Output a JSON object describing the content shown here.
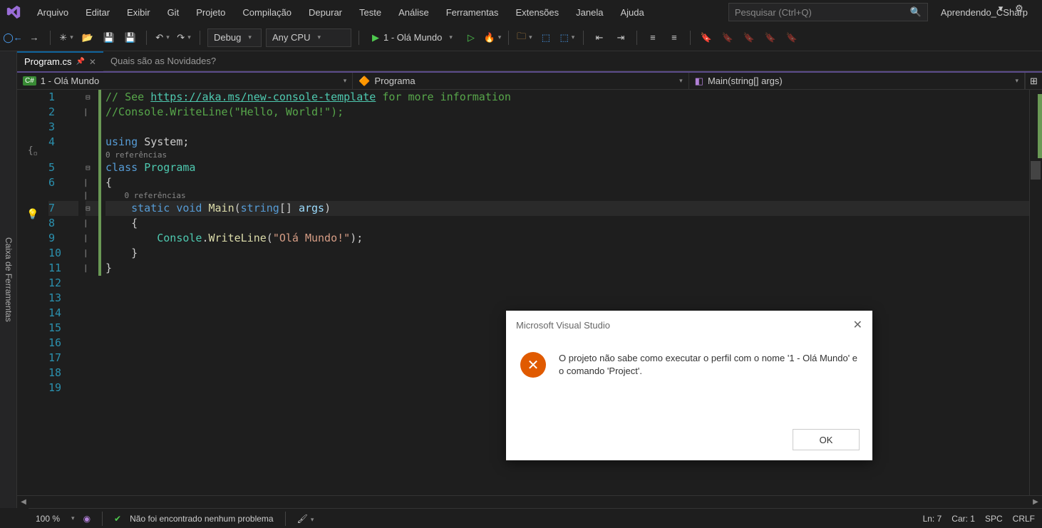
{
  "menu": {
    "items": [
      "Arquivo",
      "Editar",
      "Exibir",
      "Git",
      "Projeto",
      "Compilação",
      "Depurar",
      "Teste",
      "Análise",
      "Ferramentas",
      "Extensões",
      "Janela",
      "Ajuda"
    ]
  },
  "search": {
    "placeholder": "Pesquisar (Ctrl+Q)"
  },
  "solution_name": "Aprendendo_CSharp",
  "toolbar": {
    "config": "Debug",
    "platform": "Any CPU",
    "startup": "1 - Olá Mundo"
  },
  "sidepanel": {
    "label": "Caixa de Ferramentas"
  },
  "tabs": {
    "active": "Program.cs",
    "inactive": "Quais são as Novidades?"
  },
  "navbar": {
    "project": "1 - Olá Mundo",
    "class": "Programa",
    "method": "Main(string[] args)"
  },
  "code": {
    "ref_label": "0 referências",
    "comment_url": "https://aka.ms/new-console-template",
    "comment_prefix": "// See ",
    "comment_suffix": " for more information",
    "comment2": "//Console.WriteLine(\"Hello, World!\");",
    "using_kw": "using",
    "using_ns": "System",
    "class_kw": "class",
    "class_name": "Programa",
    "static_kw": "static",
    "void_kw": "void",
    "main_fn": "Main",
    "string_kw": "string",
    "args_id": "args",
    "console_tp": "Console",
    "writeln_fn": "WriteLine",
    "hello_str": "\"Olá Mundo!\"",
    "line_numbers": [
      "1",
      "2",
      "3",
      "4",
      "5",
      "6",
      "7",
      "8",
      "9",
      "10",
      "11",
      "12",
      "13",
      "14",
      "15",
      "16",
      "17",
      "18",
      "19"
    ]
  },
  "status": {
    "zoom": "100 %",
    "issues": "Não foi encontrado nenhum problema",
    "ln": "Ln: 7",
    "col": "Car: 1",
    "spc": "SPC",
    "eol": "CRLF"
  },
  "dialog": {
    "title": "Microsoft Visual Studio",
    "message": "O projeto não sabe como executar o perfil com o nome '1 - Olá Mundo' e o comando 'Project'.",
    "ok": "OK"
  }
}
